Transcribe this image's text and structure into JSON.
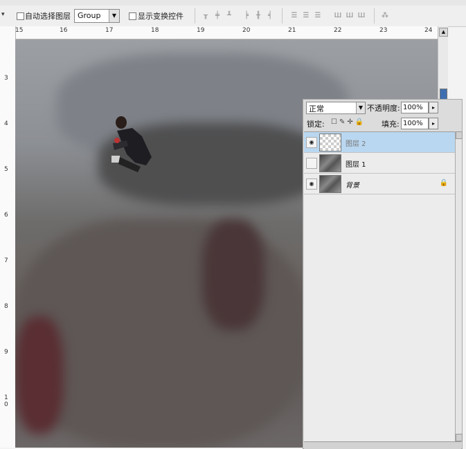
{
  "options_bar": {
    "auto_select_label": "自动选择图层",
    "group_value": "Group",
    "show_transform_label": "显示变换控件",
    "align_icons": [
      "align-top-icon",
      "align-vcenter-icon",
      "align-bottom-icon",
      "align-left-icon",
      "align-hcenter-icon",
      "align-right-icon"
    ],
    "distribute_icons": [
      "dist-top-icon",
      "dist-vcenter-icon",
      "dist-bottom-icon",
      "dist-left-icon",
      "dist-hcenter-icon",
      "dist-right-icon"
    ]
  },
  "rulers": {
    "horizontal": [
      "15",
      "16",
      "17",
      "18",
      "19",
      "20",
      "21",
      "22",
      "23",
      "24"
    ],
    "vertical": [
      "3",
      "4",
      "5",
      "6",
      "7",
      "8",
      "9",
      "1 0"
    ]
  },
  "layers_panel": {
    "blend_mode": "正常",
    "opacity_label": "不透明度:",
    "opacity_value": "100%",
    "lock_label": "锁定:",
    "fill_label": "填充:",
    "fill_value": "100%",
    "layers": [
      {
        "name": "图层 2",
        "visible": true,
        "selected": true,
        "thumb": "transparent"
      },
      {
        "name": "图层 1",
        "visible": false,
        "selected": false,
        "thumb": "photo"
      },
      {
        "name": "背景",
        "visible": true,
        "selected": false,
        "thumb": "photo",
        "locked": true
      }
    ]
  },
  "colors": {
    "selected_layer": "#b9d7f0",
    "scroll_thumb": "#3e6fb0"
  }
}
